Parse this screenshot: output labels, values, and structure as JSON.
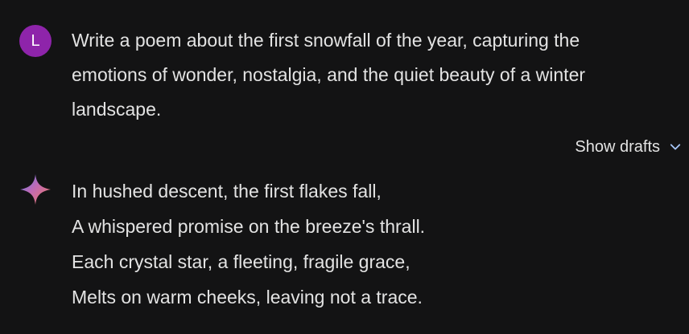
{
  "user": {
    "avatar_initial": "L",
    "avatar_color": "#8e24aa",
    "prompt": "Write a poem about the first snowfall of the year, capturing the emotions of wonder, nostalgia, and the quiet beauty of a winter landscape."
  },
  "drafts": {
    "label": "Show drafts",
    "icon": "chevron-down-icon"
  },
  "response": {
    "icon": "sparkle-icon",
    "lines": [
      "In hushed descent, the first flakes fall,",
      "A whispered promise on the breeze's thrall.",
      "Each crystal star, a fleeting, fragile grace,",
      "Melts on warm cheeks, leaving not a trace."
    ]
  },
  "colors": {
    "background": "#131314",
    "text": "#e3e3e3",
    "accent_blue": "#a8c7fa",
    "sparkle_start": "#4285f4",
    "sparkle_end": "#e8706a"
  }
}
